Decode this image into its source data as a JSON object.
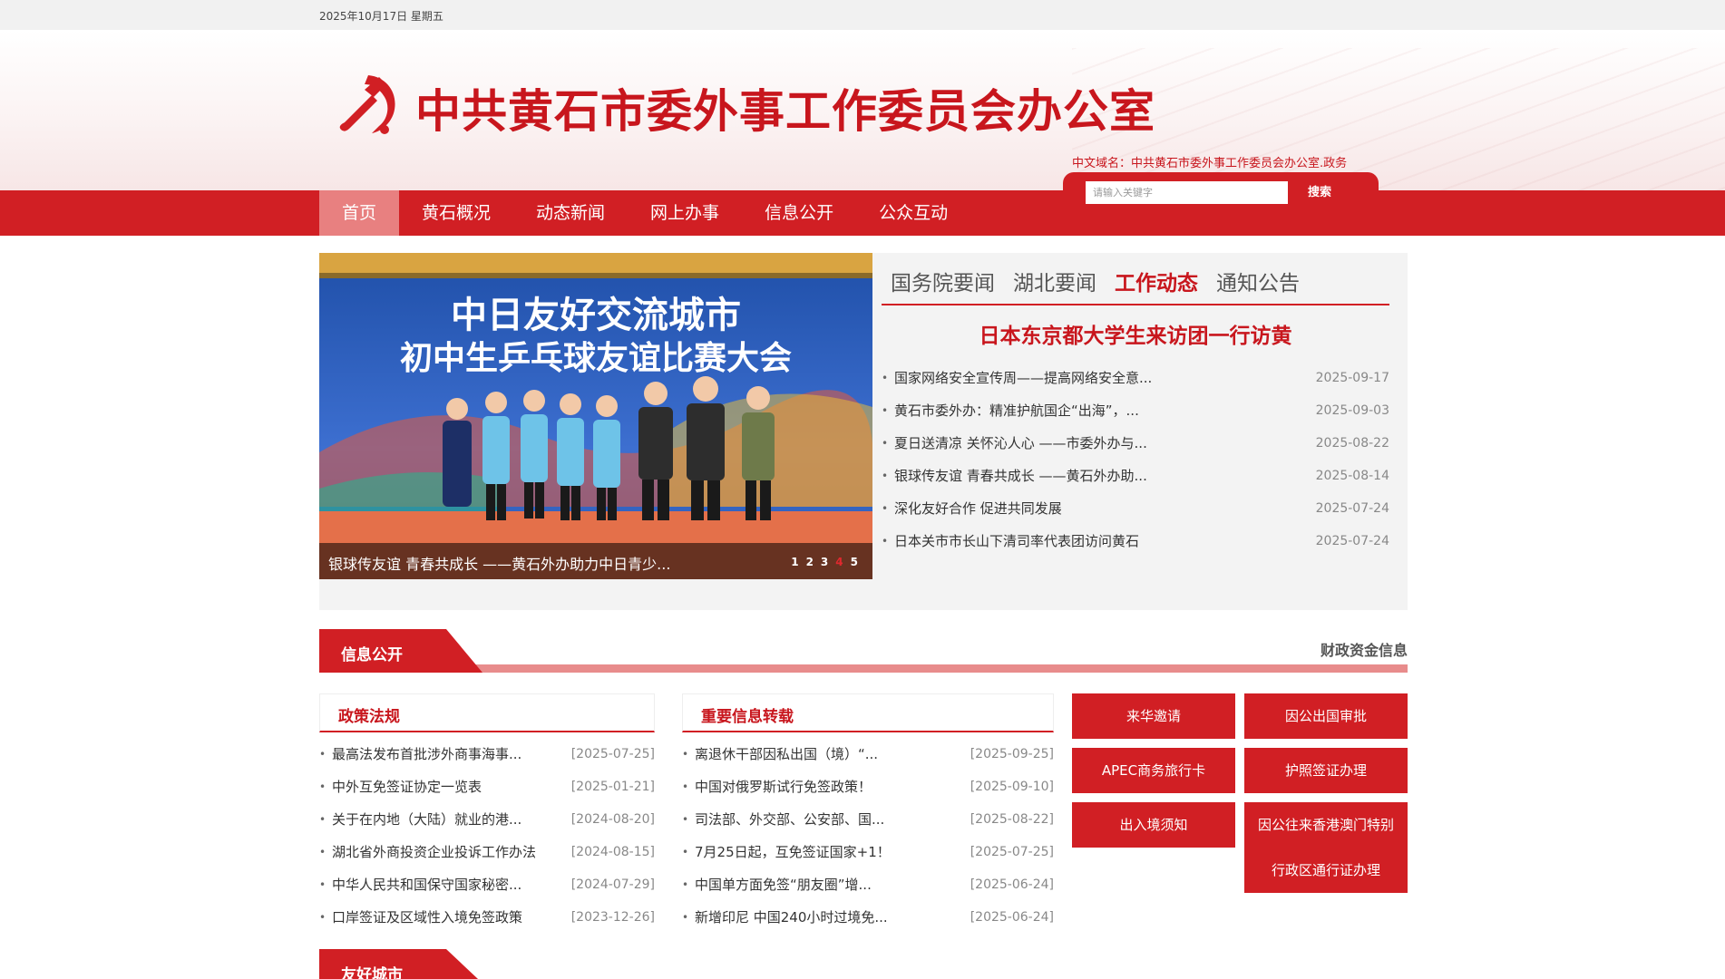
{
  "topbar": {
    "date": "2025年10月17日 星期五"
  },
  "header": {
    "title": "中共黄石市委外事工作委员会办公室",
    "domain": "中文域名：中共黄石市委外事工作委员会办公室.政务",
    "emblem_icon": "party-emblem-icon"
  },
  "nav": {
    "items": [
      "首页",
      "黄石概况",
      "动态新闻",
      "网上办事",
      "信息公开",
      "公众互动"
    ],
    "active_index": 0
  },
  "search": {
    "placeholder": "请输入关键字",
    "button": "搜索"
  },
  "slider": {
    "banner_line1": "中日友好交流城市",
    "banner_line2": "初中生乒乓球友谊比赛大会",
    "caption": "银球传友谊 青春共成长 ——黄石外办助力中日青少...",
    "dots": [
      "1",
      "2",
      "3",
      "4",
      "5"
    ],
    "active_dot": 3
  },
  "news": {
    "tabs": [
      "国务院要闻",
      "湖北要闻",
      "工作动态",
      "通知公告"
    ],
    "active_tab": 2,
    "headline": "日本东京都大学生来访团一行访黄",
    "items": [
      {
        "title": "国家网络安全宣传周——提高网络安全意...",
        "date": "2025-09-17"
      },
      {
        "title": "黄石市委外办：精准护航国企“出海”，...",
        "date": "2025-09-03"
      },
      {
        "title": "夏日送清凉 关怀沁人心 ——市委外办与...",
        "date": "2025-08-22"
      },
      {
        "title": "银球传友谊 青春共成长 ——黄石外办助...",
        "date": "2025-08-14"
      },
      {
        "title": "深化友好合作 促进共同发展",
        "date": "2025-07-24"
      },
      {
        "title": "日本关市市长山下清司率代表团访问黄石",
        "date": "2025-07-24"
      }
    ]
  },
  "info_section": {
    "title": "信息公开",
    "more": "财政资金信息"
  },
  "policy": {
    "title": "政策法规",
    "items": [
      {
        "title": "最高法发布首批涉外商事海事...",
        "date": "[2025-07-25]"
      },
      {
        "title": "中外互免签证协定一览表",
        "date": "[2025-01-21]"
      },
      {
        "title": "关于在内地（大陆）就业的港...",
        "date": "[2024-08-20]"
      },
      {
        "title": "湖北省外商投资企业投诉工作办法",
        "date": "[2024-08-15]"
      },
      {
        "title": "中华人民共和国保守国家秘密...",
        "date": "[2024-07-29]"
      },
      {
        "title": "口岸签证及区域性入境免签政策",
        "date": "[2023-12-26]"
      }
    ]
  },
  "forward": {
    "title": "重要信息转载",
    "items": [
      {
        "title": "离退休干部因私出国（境）“...",
        "date": "[2025-09-25]"
      },
      {
        "title": "中国对俄罗斯试行免签政策！",
        "date": "[2025-09-10]"
      },
      {
        "title": "司法部、外交部、公安部、国...",
        "date": "[2025-08-22]"
      },
      {
        "title": "7月25日起，互免签证国家+1！",
        "date": "[2025-07-25]"
      },
      {
        "title": "中国单方面免签“朋友圈”增...",
        "date": "[2025-06-24]"
      },
      {
        "title": "新增印尼 中国240小时过境免...",
        "date": "[2025-06-24]"
      }
    ]
  },
  "services": {
    "invite": "来华邀请",
    "official_abroad": "因公出国审批",
    "apec": "APEC商务旅行卡",
    "passport": "护照签证办理",
    "exit_entry": "出入境须知",
    "hk_macao_line1": "因公往来香港澳门特别",
    "hk_macao_line2": "行政区通行证办理"
  },
  "friendly_section": {
    "title": "友好城市"
  },
  "colors": {
    "brand_red": "#d11f24",
    "title_red": "#c8161d",
    "nav_active": "#e88080"
  }
}
